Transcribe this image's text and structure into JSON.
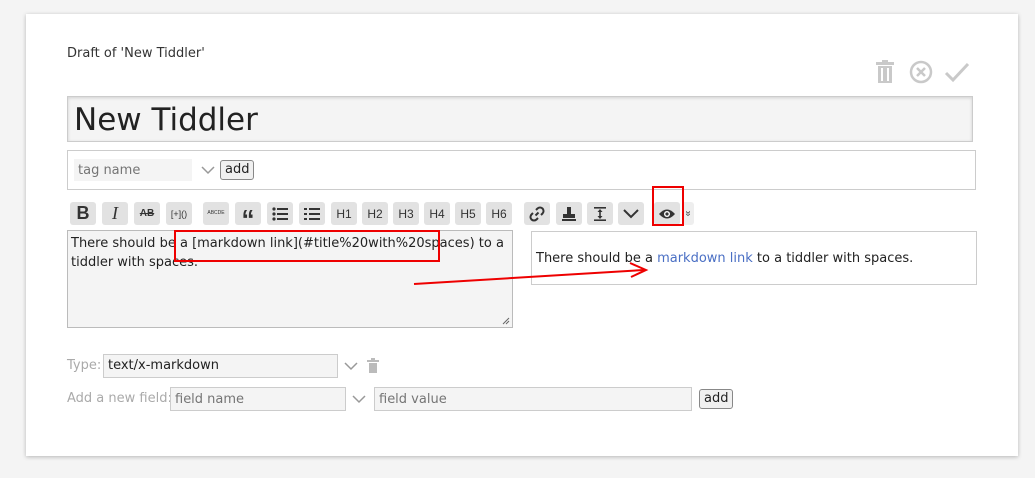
{
  "window": {
    "draft_title": "Draft of 'New Tiddler'"
  },
  "top_actions": [
    {
      "name": "delete",
      "icon": "trash-icon"
    },
    {
      "name": "cancel",
      "icon": "close-circle-icon"
    },
    {
      "name": "done",
      "icon": "checkmark-icon"
    }
  ],
  "title_field": {
    "value": "New Tiddler"
  },
  "tags": {
    "placeholder": "tag name",
    "add_label": "add"
  },
  "toolbar": {
    "buttons": [
      {
        "label": "B",
        "icon": "bold-icon"
      },
      {
        "label": "I",
        "icon": "italic-icon"
      },
      {
        "label": "AB",
        "icon": "strikethrough-icon"
      },
      {
        "label": "[+]()",
        "icon": "transclude-icon"
      },
      {
        "label": "ABCDE",
        "icon": "excise-icon"
      },
      {
        "label": "“",
        "icon": "quote-icon"
      },
      {
        "label": "",
        "icon": "bullet-list-icon"
      },
      {
        "label": "",
        "icon": "numbered-list-icon"
      },
      {
        "label": "H1",
        "icon": "heading-1-icon"
      },
      {
        "label": "H2",
        "icon": "heading-2-icon"
      },
      {
        "label": "H3",
        "icon": "heading-3-icon"
      },
      {
        "label": "H4",
        "icon": "heading-4-icon"
      },
      {
        "label": "H5",
        "icon": "heading-5-icon"
      },
      {
        "label": "H6",
        "icon": "heading-6-icon"
      },
      {
        "label": "",
        "icon": "link-icon"
      },
      {
        "label": "",
        "icon": "stamp-icon"
      },
      {
        "label": "",
        "icon": "size-icon"
      },
      {
        "label": "",
        "icon": "chevron-down-icon"
      },
      {
        "label": "",
        "icon": "eye-icon"
      },
      {
        "label": "»",
        "icon": "more-icon"
      }
    ]
  },
  "editor": {
    "text_before": "There should be a ",
    "text_markdown": "[markdown link](#title%20with%20spaces)",
    "text_after": " to a tiddler with spaces."
  },
  "preview": {
    "text_before": "There should be a ",
    "link_text": "markdown link",
    "text_after": " to a tiddler with spaces."
  },
  "type_field": {
    "label": "Type:",
    "value": "text/x-markdown"
  },
  "new_field": {
    "label": "Add a new field:",
    "name_placeholder": "field name",
    "value_placeholder": "field value",
    "add_label": "add"
  },
  "colors": {
    "accent_link": "#4a6fc4",
    "highlight_red": "#e00000"
  }
}
